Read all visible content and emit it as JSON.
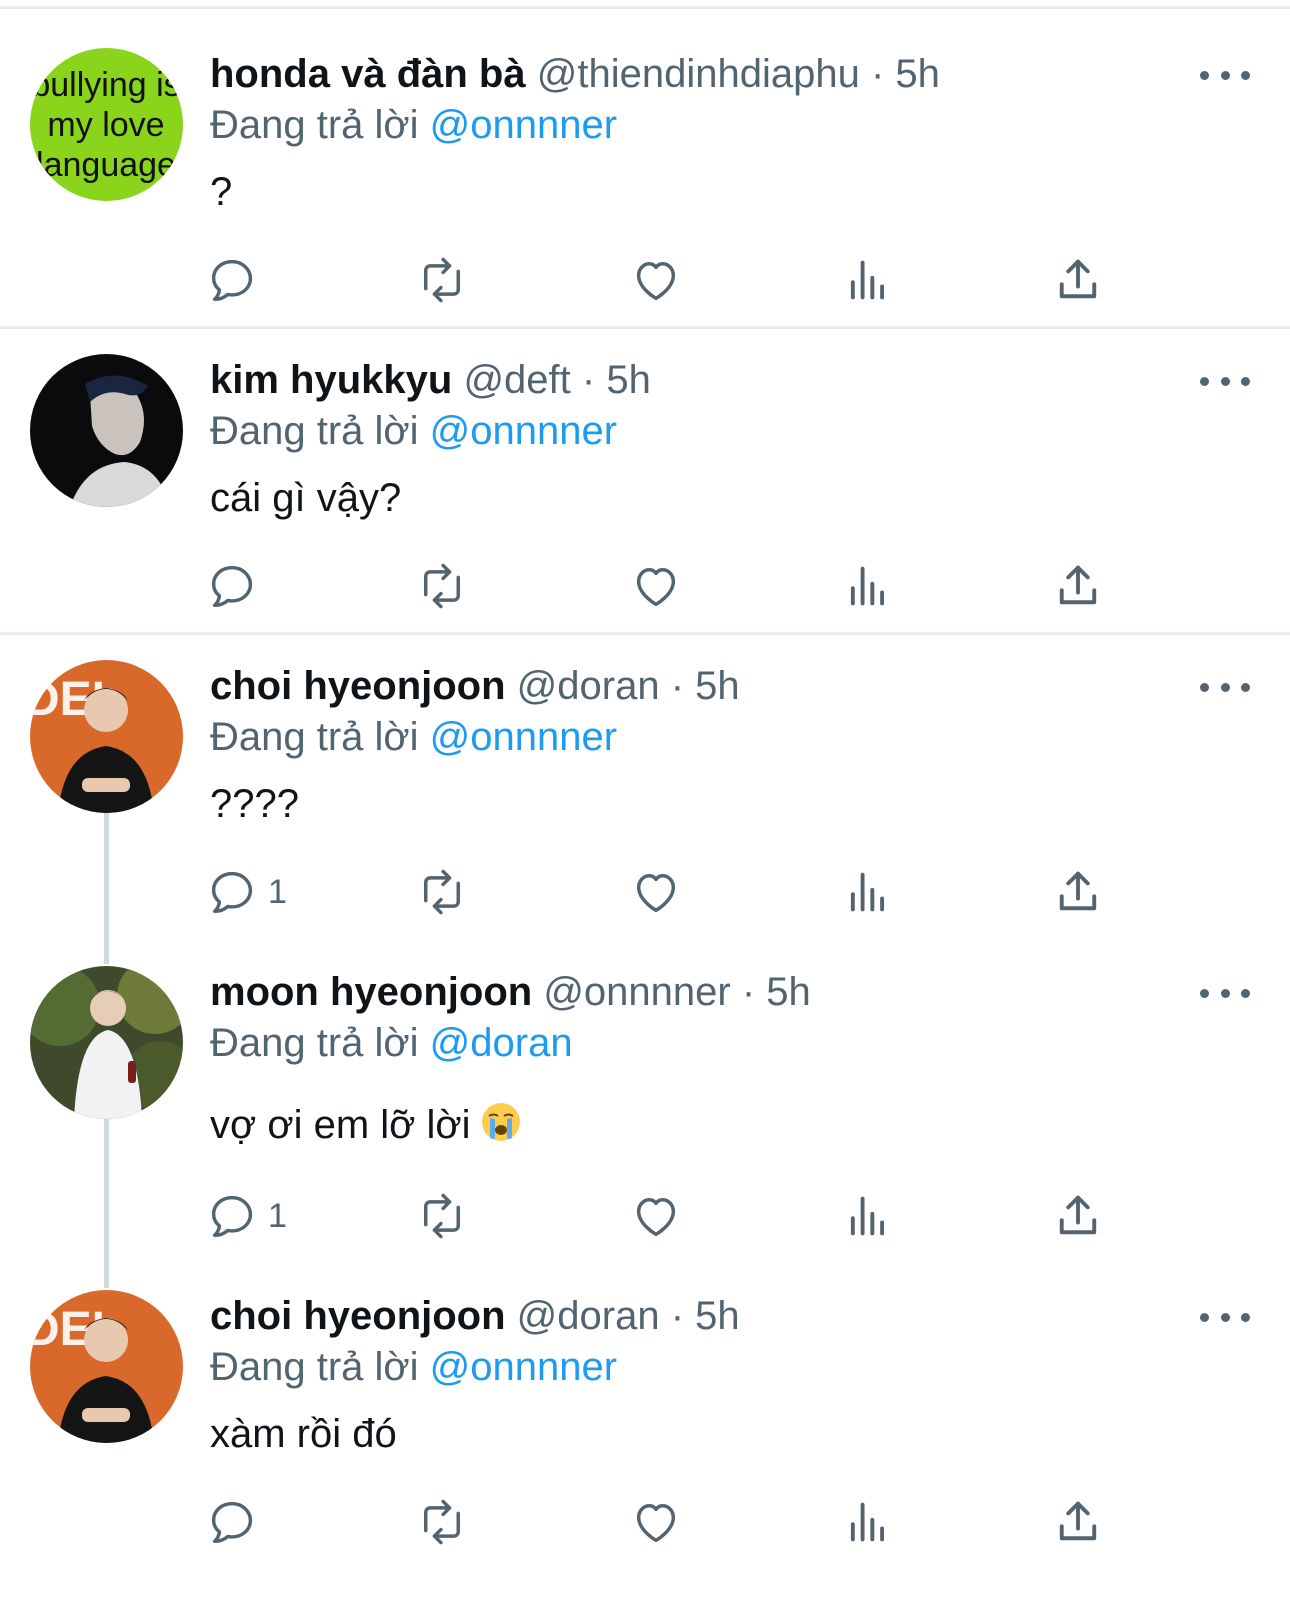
{
  "tweets": [
    {
      "name": "honda và đàn bà",
      "handle": "@thiendinhdiaphu",
      "time": "5h",
      "replying_label": "Đang trả lời",
      "replying_to": "@onnnner",
      "text": "?",
      "reply_count": "",
      "avatar_text": [
        "bullying is",
        "my love",
        "language"
      ]
    },
    {
      "name": "kim hyukkyu",
      "handle": "@deft",
      "time": "5h",
      "replying_label": "Đang trả lời",
      "replying_to": "@onnnner",
      "text": "cái gì vậy?",
      "reply_count": ""
    },
    {
      "name": "choi hyeonjoon",
      "handle": "@doran",
      "time": "5h",
      "replying_label": "Đang trả lời",
      "replying_to": "@onnnner",
      "text": "????",
      "reply_count": "1"
    },
    {
      "name": "moon hyeonjoon",
      "handle": "@onnnner",
      "time": "5h",
      "replying_label": "Đang trả lời",
      "replying_to": "@doran",
      "text": "vợ ơi em lỡ lời",
      "reply_count": "1",
      "emoji": "loudly-crying-face"
    },
    {
      "name": "choi hyeonjoon",
      "handle": "@doran",
      "time": "5h",
      "replying_label": "Đang trả lời",
      "replying_to": "@onnnner",
      "text": "xàm rồi đó",
      "reply_count": ""
    }
  ],
  "separator": "·",
  "colors": {
    "text": "#0f1419",
    "secondary": "#536471",
    "link": "#1d9bf0",
    "divider": "#e6ecf0",
    "thread_line": "#cfd9de"
  },
  "icons": [
    "reply-icon",
    "retweet-icon",
    "like-icon",
    "views-icon",
    "share-icon",
    "more-icon"
  ]
}
